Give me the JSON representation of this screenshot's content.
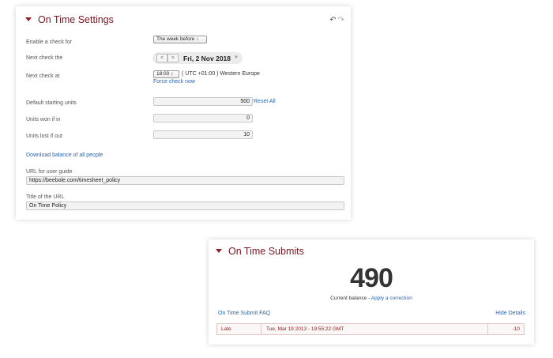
{
  "settings": {
    "title": "On Time Settings",
    "enable_label": "Enable a check for",
    "enable_value": "The week before",
    "next_check_label": "Next check the",
    "date_prev": "<",
    "date_next": ">",
    "next_check_date": "Fri, 2 Nov 2018",
    "next_check_at_label": "Next check at",
    "time_value": "18:00",
    "timezone_text": "( UTC +01:00 ) Western Europe",
    "force_check_link": "Force check now",
    "default_units_label": "Default starting units",
    "default_units_value": "500",
    "reset_all_link": "Reset All",
    "units_won_label": "Units won if in",
    "units_won_value": "0",
    "units_lost_label": "Units lost if out",
    "units_lost_value": "10",
    "download_link": "Download balance of all people",
    "url_guide_label": "URL for user guide",
    "url_guide_value": "https://beebole.com/timesheet_policy",
    "url_title_label": "Title of the URL",
    "url_title_value": "On Time Policy"
  },
  "submits": {
    "title": "On Time Submits",
    "balance_value": "490",
    "balance_label": "Current balance -",
    "apply_correction_link": "Apply a correction",
    "faq_link": "On Time Submit FAQ",
    "hide_details_link": "Hide Details",
    "rows": [
      {
        "status": "Late",
        "timestamp": "Tue, Mar 19 2013 - 19:55:22 GMT",
        "value": "-10"
      }
    ]
  },
  "icons": {
    "undo": "undo-icon",
    "redo": "redo-icon",
    "collapse": "caret-down-icon"
  },
  "colors": {
    "title": "#7a1420",
    "link": "#2a66b0",
    "late_text": "#8b1a1a"
  }
}
